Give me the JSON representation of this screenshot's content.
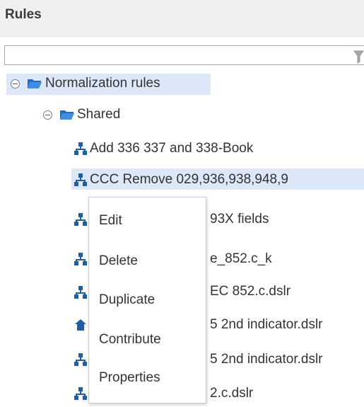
{
  "panel": {
    "title": "Rules"
  },
  "filter": {
    "value": "",
    "icon": "filter-icon"
  },
  "tree": {
    "root": {
      "label": "Normalization rules",
      "icon": "folder-open-icon",
      "expanded": true
    },
    "shared": {
      "label": "Shared",
      "icon": "folder-open-icon",
      "expanded": true
    },
    "rules": [
      {
        "label": "Add 336 337 and 338-Book",
        "icon": "rule-tree-icon",
        "selected": false
      },
      {
        "label": "CCC Remove 029,936,938,948,9",
        "icon": "rule-tree-icon",
        "selected": true
      },
      {
        "label": "93X fields",
        "icon": "rule-tree-icon",
        "selected": false
      },
      {
        "label": "e_852.c_k",
        "icon": "rule-tree-icon",
        "selected": false
      },
      {
        "label": "EC 852.c.dslr",
        "icon": "rule-tree-icon",
        "selected": false
      },
      {
        "label": "5 2nd indicator.dslr",
        "icon": "home-icon",
        "selected": false
      },
      {
        "label": "5 2nd indicator.dslr",
        "icon": "rule-tree-icon",
        "selected": false
      },
      {
        "label": "2.c.dslr",
        "icon": "rule-tree-icon",
        "selected": false
      }
    ]
  },
  "context_menu": {
    "items": [
      "Edit",
      "Delete",
      "Duplicate",
      "Contribute",
      "Properties"
    ]
  },
  "colors": {
    "selection": "#dce8f8",
    "folder": "#2f7fd1",
    "rule_icon": "#1f5f9f",
    "menu_border": "#bcd3ee"
  }
}
